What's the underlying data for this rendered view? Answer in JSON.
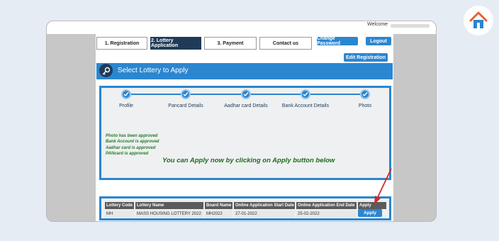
{
  "topbar": {
    "welcome": "Welcome"
  },
  "tabs": [
    {
      "label": "1. Registration"
    },
    {
      "label": "2. Lottery Application"
    },
    {
      "label": "3. Payment"
    },
    {
      "label": "Contact us"
    }
  ],
  "buttons": {
    "change_password": "Change Password",
    "logout": "Logout",
    "edit_registration": "Edit Registration"
  },
  "header": {
    "title": "Select Lottery to Apply"
  },
  "steps": [
    {
      "label": "Profile"
    },
    {
      "label": "Pancard Details"
    },
    {
      "label": "Aadhar card Details"
    },
    {
      "label": "Bank Account Details"
    },
    {
      "label": "Photo"
    }
  ],
  "status": [
    "Photo has been approved",
    "Bank Account is approved",
    "Aadhar card is approved",
    "PANcard is approved"
  ],
  "apply_message": "You can Apply now by clicking on Apply button below",
  "table": {
    "headers": [
      "Lottery Code",
      "Lottery Name",
      "Board Name",
      "Online Application Start Date",
      "Online Application End Date",
      "Apply"
    ],
    "rows": [
      [
        "MH",
        "MASS HOUSING LOTTERY 2022",
        "MH2022",
        "27-01-2022",
        "25-02-2022",
        "Apply"
      ]
    ]
  },
  "colors": {
    "accent": "#2b86d0",
    "dark": "#1f3b59",
    "success": "#1e6b1e",
    "arrow": "#d62828"
  }
}
